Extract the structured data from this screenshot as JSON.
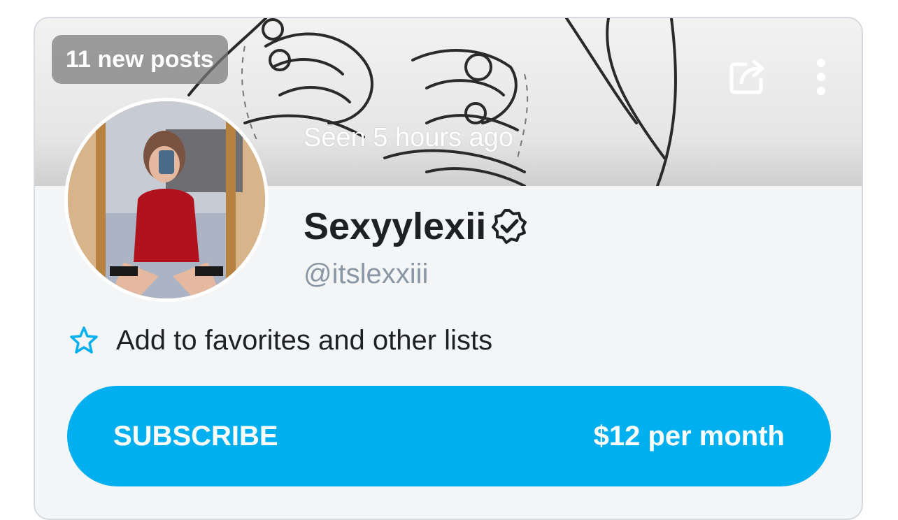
{
  "cover": {
    "new_posts_badge": "11 new posts",
    "seen_status": "Seen 5 hours ago",
    "share_icon": "share-icon",
    "more_icon": "more-vertical-icon"
  },
  "profile": {
    "display_name": "Sexyylexii",
    "verified_icon": "verified-badge-icon",
    "username": "@itslexxiii"
  },
  "favorites": {
    "icon": "star-icon",
    "label": "Add to favorites and other lists"
  },
  "subscribe": {
    "label": "SUBSCRIBE",
    "price": "$12 per month"
  },
  "colors": {
    "accent": "#00aff0",
    "card_background": "#f4f5f7",
    "handle_text": "#8a96a3",
    "primary_text": "#1f2024"
  }
}
